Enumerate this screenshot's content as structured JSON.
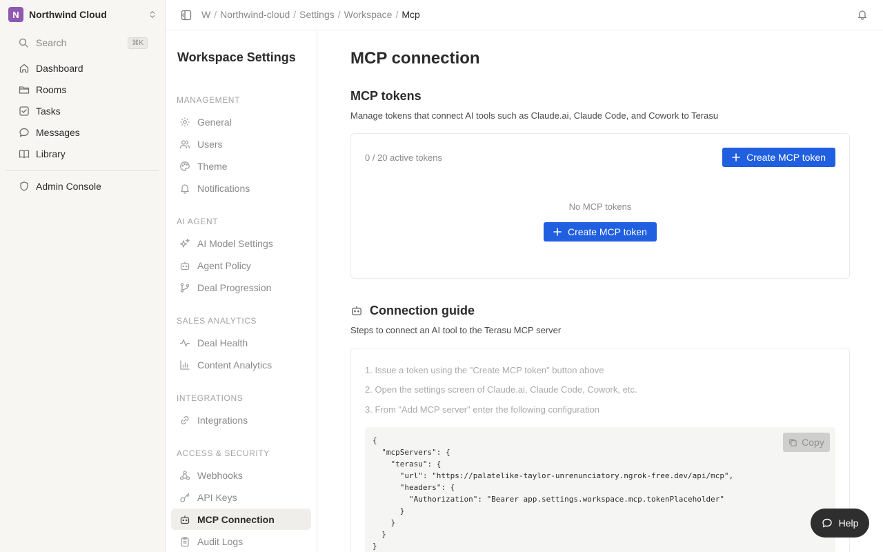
{
  "workspace": {
    "initial": "N",
    "name": "Northwind Cloud",
    "avatar_color": "#8e5ab0"
  },
  "search": {
    "label": "Search",
    "shortcut": "⌘K"
  },
  "app_nav": [
    {
      "label": "Dashboard",
      "icon": "home-icon"
    },
    {
      "label": "Rooms",
      "icon": "folder-icon"
    },
    {
      "label": "Tasks",
      "icon": "check-square-icon"
    },
    {
      "label": "Messages",
      "icon": "chat-bubble-icon"
    },
    {
      "label": "Library",
      "icon": "book-icon"
    }
  ],
  "admin": {
    "label": "Admin Console",
    "icon": "shield-icon"
  },
  "breadcrumb": [
    "W",
    "Northwind-cloud",
    "Settings",
    "Workspace",
    "Mcp"
  ],
  "settings_nav": {
    "title": "Workspace Settings",
    "sections": [
      {
        "label": "MANAGEMENT",
        "items": [
          "General",
          "Users",
          "Theme",
          "Notifications"
        ]
      },
      {
        "label": "AI AGENT",
        "items": [
          "AI Model Settings",
          "Agent Policy",
          "Deal Progression"
        ]
      },
      {
        "label": "SALES ANALYTICS",
        "items": [
          "Deal Health",
          "Content Analytics"
        ]
      },
      {
        "label": "INTEGRATIONS",
        "items": [
          "Integrations"
        ]
      },
      {
        "label": "ACCESS & SECURITY",
        "items": [
          "Webhooks",
          "API Keys",
          "MCP Connection",
          "Audit Logs"
        ]
      }
    ],
    "active": "MCP Connection"
  },
  "main": {
    "title": "MCP connection",
    "tokens": {
      "heading": "MCP tokens",
      "description": "Manage tokens that connect AI tools such as Claude.ai, Claude Code, and Cowork to Terasu",
      "count": "0 / 20 active tokens",
      "create_label": "Create MCP token",
      "empty_text": "No MCP tokens",
      "empty_create_label": "Create MCP token"
    },
    "guide": {
      "heading": "Connection guide",
      "description": "Steps to connect an AI tool to the Terasu MCP server",
      "steps": [
        "1. Issue a token using the \"Create MCP token\" button above",
        "2. Open the settings screen of Claude.ai, Claude Code, Cowork, etc.",
        "3. From \"Add MCP server\" enter the following configuration"
      ],
      "copy_label": "Copy",
      "code": "{\n  \"mcpServers\": {\n    \"terasu\": {\n      \"url\": \"https://palatelike-taylor-unrenunciatory.ngrok-free.dev/api/mcp\",\n      \"headers\": {\n        \"Authorization\": \"Bearer app.settings.workspace.mcp.tokenPlaceholder\"\n      }\n    }\n  }\n}"
    }
  },
  "help": {
    "label": "Help"
  },
  "colors": {
    "accent": "#1f5fe0",
    "sidebar_bg": "#f7f6f3",
    "active_item_bg": "#efeeeb"
  }
}
